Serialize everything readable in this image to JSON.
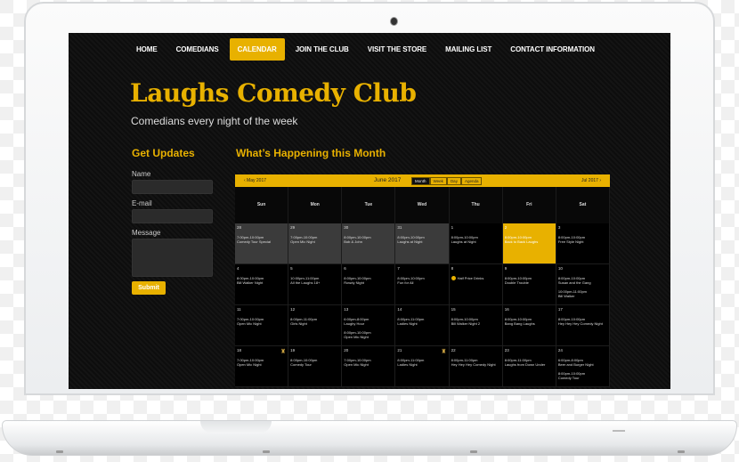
{
  "nav": {
    "items": [
      {
        "label": "HOME",
        "active": false
      },
      {
        "label": "COMEDIANS",
        "active": false
      },
      {
        "label": "CALENDAR",
        "active": true
      },
      {
        "label": "JOIN THE CLUB",
        "active": false
      },
      {
        "label": "VISIT THE STORE",
        "active": false
      },
      {
        "label": "MAILING LIST",
        "active": false
      },
      {
        "label": "CONTACT INFORMATION",
        "active": false
      }
    ]
  },
  "site": {
    "title": "Laughs Comedy Club",
    "tagline": "Comedians every night of the week"
  },
  "sidebar": {
    "heading": "Get Updates",
    "name_label": "Name",
    "email_label": "E-mail",
    "message_label": "Message",
    "submit_label": "Submit"
  },
  "main": {
    "heading": "What’s Happening this Month"
  },
  "calendar": {
    "prev_label": "‹ May 2017",
    "next_label": "Jul 2017 ›",
    "month_label": "June 2017",
    "views": [
      {
        "label": "Month",
        "active": true
      },
      {
        "label": "Week",
        "active": false
      },
      {
        "label": "Day",
        "active": false
      },
      {
        "label": "Agenda",
        "active": false
      }
    ],
    "weekdays": [
      "Sun",
      "Mon",
      "Tue",
      "Wed",
      "Thu",
      "Fri",
      "Sat"
    ],
    "weeks": [
      [
        {
          "day": "28",
          "state": "past",
          "events": [
            {
              "time": "7:00pm-10:00pm",
              "title": "Comedy Tour Special"
            }
          ]
        },
        {
          "day": "29",
          "state": "past",
          "events": [
            {
              "time": "7:00pm-10:00pm",
              "title": "Open Mic Night"
            }
          ]
        },
        {
          "day": "30",
          "state": "past",
          "events": [
            {
              "time": "8:00pm-10:00pm",
              "title": "Bob & John"
            }
          ]
        },
        {
          "day": "31",
          "state": "past",
          "events": [
            {
              "time": "8:00pm-10:00pm",
              "title": "Laughs at Night"
            }
          ]
        },
        {
          "day": "1",
          "state": "",
          "events": [
            {
              "time": "8:00pm-10:00pm",
              "title": "Laughs at Night"
            }
          ]
        },
        {
          "day": "2",
          "state": "today",
          "events": [
            {
              "time": "8:00pm-10:00pm",
              "title": "Back to Back Laughs"
            }
          ]
        },
        {
          "day": "3",
          "state": "",
          "events": [
            {
              "time": "8:00pm-10:00pm",
              "title": "Free Style Night"
            }
          ]
        }
      ],
      [
        {
          "day": "4",
          "state": "",
          "events": [
            {
              "time": "8:00pm-10:00pm",
              "title": "Bill Walker Night"
            }
          ]
        },
        {
          "day": "5",
          "state": "",
          "events": [
            {
              "time": "10:00pm-11:00pm",
              "title": "All the Laughs 18+"
            }
          ]
        },
        {
          "day": "6",
          "state": "",
          "events": [
            {
              "time": "8:00pm-10:00pm",
              "title": "Rowdy Night"
            }
          ]
        },
        {
          "day": "7",
          "state": "",
          "events": [
            {
              "time": "8:00pm-10:00pm",
              "title": "Fun for All"
            }
          ]
        },
        {
          "day": "8",
          "state": "",
          "badge": "Half Price Drinks",
          "events": []
        },
        {
          "day": "9",
          "state": "",
          "events": [
            {
              "time": "8:00pm-10:00pm",
              "title": "Double Trouble"
            }
          ]
        },
        {
          "day": "10",
          "state": "",
          "events": [
            {
              "time": "8:00pm-10:00pm",
              "title": "Susan and the Gang"
            },
            {
              "time": "10:00pm-11:00pm",
              "title": "Bill Walker"
            }
          ]
        }
      ],
      [
        {
          "day": "11",
          "state": "",
          "events": [
            {
              "time": "7:00pm-10:00pm",
              "title": "Open Mic Night"
            }
          ]
        },
        {
          "day": "12",
          "state": "",
          "events": [
            {
              "time": "8:00pm-11:00pm",
              "title": "Girls Night"
            }
          ]
        },
        {
          "day": "13",
          "state": "",
          "events": [
            {
              "time": "6:00pm-8:00pm",
              "title": "Laughy Hour"
            },
            {
              "time": "8:00pm-10:00pm",
              "title": "Open Mic Night"
            }
          ]
        },
        {
          "day": "14",
          "state": "",
          "events": [
            {
              "time": "8:00pm-11:00pm",
              "title": "Ladies Night"
            }
          ]
        },
        {
          "day": "15",
          "state": "",
          "events": [
            {
              "time": "8:00pm-10:00pm",
              "title": "Bill Walker Night 2"
            }
          ]
        },
        {
          "day": "16",
          "state": "",
          "events": [
            {
              "time": "8:00pm-10:00pm",
              "title": "Bang Bang Laughs"
            }
          ]
        },
        {
          "day": "17",
          "state": "",
          "events": [
            {
              "time": "8:00pm-10:00pm",
              "title": "Hey Hey Hey Comedy Night"
            }
          ]
        }
      ],
      [
        {
          "day": "18",
          "state": "",
          "trophy": true,
          "events": [
            {
              "time": "7:00pm-10:00pm",
              "title": "Open Mic Night"
            }
          ]
        },
        {
          "day": "19",
          "state": "",
          "events": [
            {
              "time": "8:00pm-10:00pm",
              "title": "Comedy Tour"
            }
          ]
        },
        {
          "day": "20",
          "state": "",
          "events": [
            {
              "time": "7:00pm-10:00pm",
              "title": "Open Mic Night"
            }
          ]
        },
        {
          "day": "21",
          "state": "",
          "trophy": true,
          "events": [
            {
              "time": "8:00pm-11:00pm",
              "title": "Ladies Night"
            }
          ]
        },
        {
          "day": "22",
          "state": "",
          "events": [
            {
              "time": "8:00pm-11:00pm",
              "title": "Hey Hey Hey Comedy Night"
            }
          ]
        },
        {
          "day": "23",
          "state": "",
          "events": [
            {
              "time": "8:00pm-11:00pm",
              "title": "Laughs from Down Under"
            }
          ]
        },
        {
          "day": "24",
          "state": "",
          "events": [
            {
              "time": "6:00pm-8:00pm",
              "title": "Beer and Burger Night"
            },
            {
              "time": "8:00pm-10:00pm",
              "title": "Comedy Tour"
            }
          ]
        }
      ]
    ]
  }
}
